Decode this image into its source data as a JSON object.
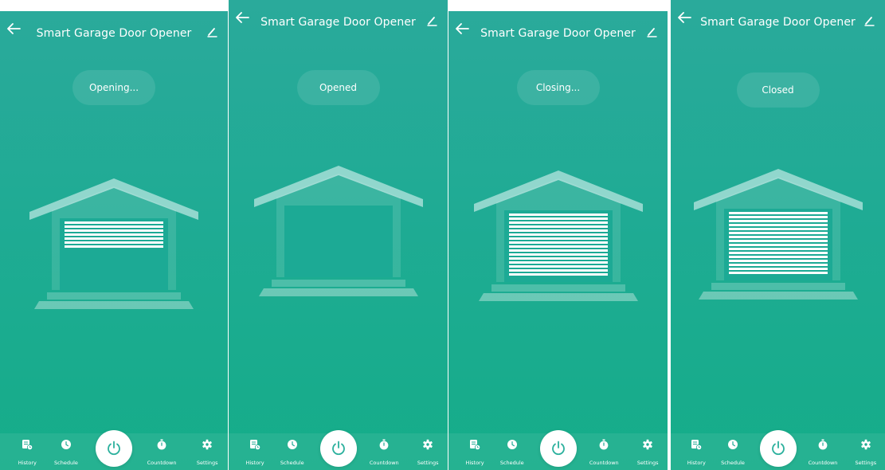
{
  "screens": [
    {
      "title": "Smart Garage Door Opener",
      "status": "Opening...",
      "door_open_fraction": 0.55,
      "nav": [
        "History",
        "Schedule",
        "Countdown",
        "Settings"
      ]
    },
    {
      "title": "Smart Garage Door Opener",
      "status": "Opened",
      "door_open_fraction": 1.0,
      "nav": [
        "History",
        "Schedule",
        "Countdown",
        "Settings"
      ]
    },
    {
      "title": "Smart Garage Door Opener",
      "status": "Closing...",
      "door_open_fraction": 0.0,
      "nav": [
        "History",
        "Schedule",
        "Countdown",
        "Settings"
      ]
    },
    {
      "title": "Smart Garage Door Opener",
      "status": "Closed",
      "door_open_fraction": 0.0,
      "nav": [
        "History",
        "Schedule",
        "Countdown",
        "Settings"
      ]
    }
  ],
  "icons": {
    "back": "back-arrow-icon",
    "edit": "edit-pencil-icon",
    "power": "power-icon",
    "history": "history-icon",
    "schedule": "clock-icon",
    "countdown": "stopwatch-icon",
    "settings": "gear-icon"
  },
  "colors": {
    "background_top": "#2aaa9b",
    "background_bottom": "#15ad89",
    "power_icon": "#2bb09d"
  }
}
